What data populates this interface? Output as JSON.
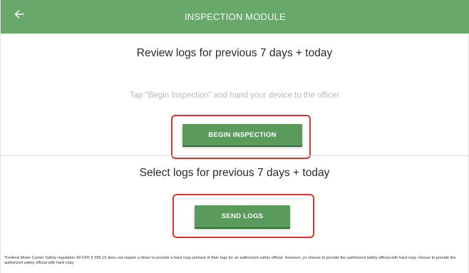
{
  "header": {
    "title": "INSPECTION MODULE",
    "back_icon": "arrow-left-icon"
  },
  "review_section": {
    "title": "Review logs for previous 7 days + today",
    "hint": "Tap \"Begin Inspection\" and hand your device to the officer",
    "button_label": "BEGIN INSPECTION"
  },
  "send_section": {
    "title": "Select logs for previous 7 days + today",
    "button_label": "SEND LOGS"
  },
  "footnote": {
    "text": "*Federal Motor Carrier Safety regulation 49 CFR § 395.15 does not require a driver to provide a hard copy printout of their logs for an authorized safety official. However, yo  choose to provide the authorized safety official with hard copy choose to provide the authorized safety official with hard copy"
  },
  "colors": {
    "header_bg": "#68a86a",
    "button_bg": "#5a9b5c",
    "highlight": "#e0312d"
  }
}
